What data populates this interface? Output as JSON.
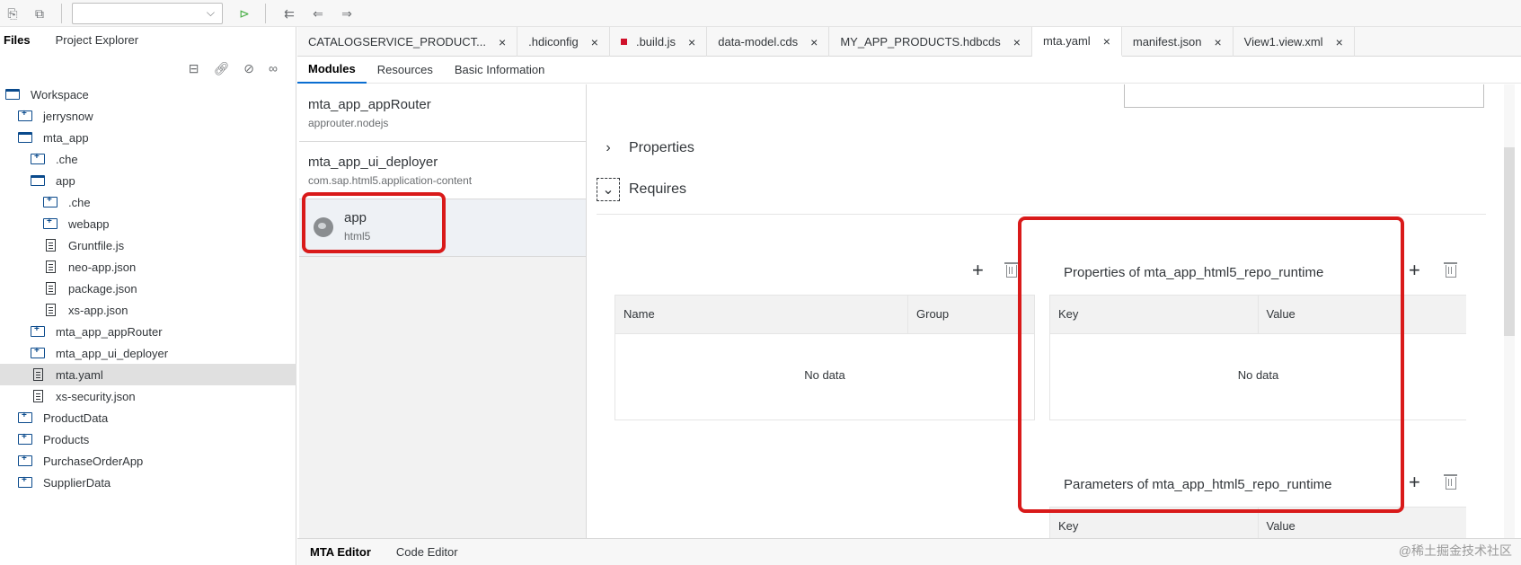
{
  "toolbar": {
    "run_selector_value": ""
  },
  "sidebar": {
    "tabs": [
      "Files",
      "Project Explorer"
    ],
    "tree": [
      {
        "label": "Workspace",
        "kind": "folder-open",
        "level": 0
      },
      {
        "label": "jerrysnow",
        "kind": "folder",
        "level": 1
      },
      {
        "label": "mta_app",
        "kind": "folder-open",
        "level": 1
      },
      {
        "label": ".che",
        "kind": "folder",
        "level": 2
      },
      {
        "label": "app",
        "kind": "folder-open",
        "level": 2
      },
      {
        "label": ".che",
        "kind": "folder",
        "level": 3
      },
      {
        "label": "webapp",
        "kind": "folder",
        "level": 3
      },
      {
        "label": "Gruntfile.js",
        "kind": "file",
        "level": 3
      },
      {
        "label": "neo-app.json",
        "kind": "file",
        "level": 3
      },
      {
        "label": "package.json",
        "kind": "file",
        "level": 3
      },
      {
        "label": "xs-app.json",
        "kind": "file",
        "level": 3
      },
      {
        "label": "mta_app_appRouter",
        "kind": "folder",
        "level": 2
      },
      {
        "label": "mta_app_ui_deployer",
        "kind": "folder",
        "level": 2
      },
      {
        "label": "mta.yaml",
        "kind": "file",
        "level": 2,
        "selected": true
      },
      {
        "label": "xs-security.json",
        "kind": "file",
        "level": 2
      },
      {
        "label": "ProductData",
        "kind": "folder",
        "level": 1
      },
      {
        "label": "Products",
        "kind": "folder",
        "level": 1
      },
      {
        "label": "PurchaseOrderApp",
        "kind": "folder",
        "level": 1
      },
      {
        "label": "SupplierData",
        "kind": "folder",
        "level": 1
      }
    ]
  },
  "editor_tabs": [
    {
      "label": "CATALOGSERVICE_PRODUCT..."
    },
    {
      "label": ".hdiconfig"
    },
    {
      "label": ".build.js",
      "dirty": true
    },
    {
      "label": "data-model.cds"
    },
    {
      "label": "MY_APP_PRODUCTS.hdbcds"
    },
    {
      "label": "mta.yaml",
      "active": true
    },
    {
      "label": "manifest.json"
    },
    {
      "label": "View1.view.xml"
    }
  ],
  "subtabs": [
    "Modules",
    "Resources",
    "Basic Information"
  ],
  "modules": [
    {
      "name": "mta_app_appRouter",
      "type": "approuter.nodejs"
    },
    {
      "name": "mta_app_ui_deployer",
      "type": "com.sap.html5.application-content"
    },
    {
      "name": "app",
      "type": "html5",
      "selected": true
    }
  ],
  "details": {
    "properties_label": "Properties",
    "requires_label": "Requires",
    "requires_table": {
      "columns": [
        "Name",
        "Group"
      ],
      "empty": "No data"
    },
    "props_table": {
      "title": "Properties of mta_app_html5_repo_runtime",
      "columns": [
        "Key",
        "Value"
      ],
      "empty": "No data"
    },
    "params_table": {
      "title": "Parameters of mta_app_html5_repo_runtime",
      "columns": [
        "Key",
        "Value"
      ]
    }
  },
  "bottom_tabs": [
    "MTA Editor",
    "Code Editor"
  ],
  "watermark": "@稀土掘金技术社区",
  "colors": {
    "accent": "#0a6ed1",
    "highlight": "#d91a1a"
  }
}
